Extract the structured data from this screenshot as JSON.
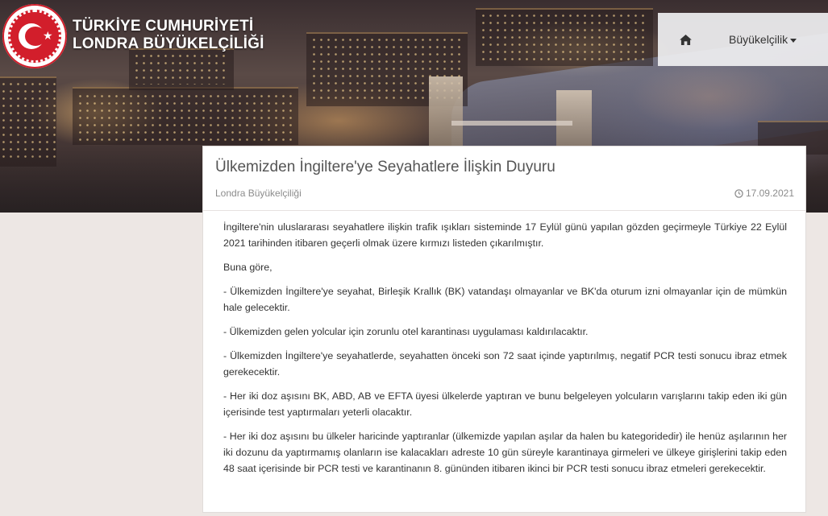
{
  "header": {
    "brand_line1": "TÜRKİYE CUMHURİYETİ",
    "brand_line2": "LONDRA BÜYÜKELÇİLİĞİ",
    "logo_icon": "turkish-crescent-star-emblem",
    "nav": {
      "home_icon": "home-icon",
      "embassy_label": "Büyükelçilik"
    }
  },
  "article": {
    "title": "Ülkemizden İngiltere'ye Seyahatlere İlişkin Duyuru",
    "author": "Londra Büyükelçiliği",
    "date": "17.09.2021",
    "paragraphs": [
      "İngiltere'nin uluslararası seyahatlere ilişkin trafik ışıkları sisteminde 17 Eylül günü yapılan gözden geçirmeyle Türkiye 22 Eylül 2021 tarihinden itibaren geçerli olmak üzere kırmızı listeden çıkarılmıştır.",
      "Buna göre,",
      "- Ülkemizden İngiltere'ye seyahat, Birleşik Krallık (BK) vatandaşı olmayanlar ve BK'da oturum izni olmayanlar için de mümkün hale gelecektir.",
      "- Ülkemizden gelen yolcular için zorunlu otel karantinası uygulaması kaldırılacaktır.",
      "- Ülkemizden İngiltere'ye seyahatlerde, seyahatten önceki son 72 saat içinde yaptırılmış, negatif PCR testi sonucu ibraz etmek gerekecektir.",
      "- Her iki doz aşısını BK, ABD, AB ve EFTA üyesi ülkelerde yaptıran ve bunu belgeleyen yolcuların varışlarını takip eden iki gün içerisinde test yaptırmaları yeterli olacaktır.",
      "- Her iki doz aşısını bu ülkeler haricinde yaptıranlar (ülkemizde yapılan aşılar da halen bu kategoridedir) ile henüz aşılarının her iki dozunu da yaptırmamış olanların ise kalacakları adreste 10 gün süreyle karantinaya girmeleri ve ülkeye girişlerini takip eden 48 saat içerisinde bir PCR testi ve karantinanın 8. gününden itibaren ikinci bir PCR testi sonucu ibraz etmeleri gerekecektir."
    ]
  },
  "colors": {
    "brand_red": "#d21e2b",
    "page_bg": "#ede7e4",
    "card_bg": "#ffffff",
    "title_text": "#555555",
    "meta_text": "#8c8c8c"
  }
}
